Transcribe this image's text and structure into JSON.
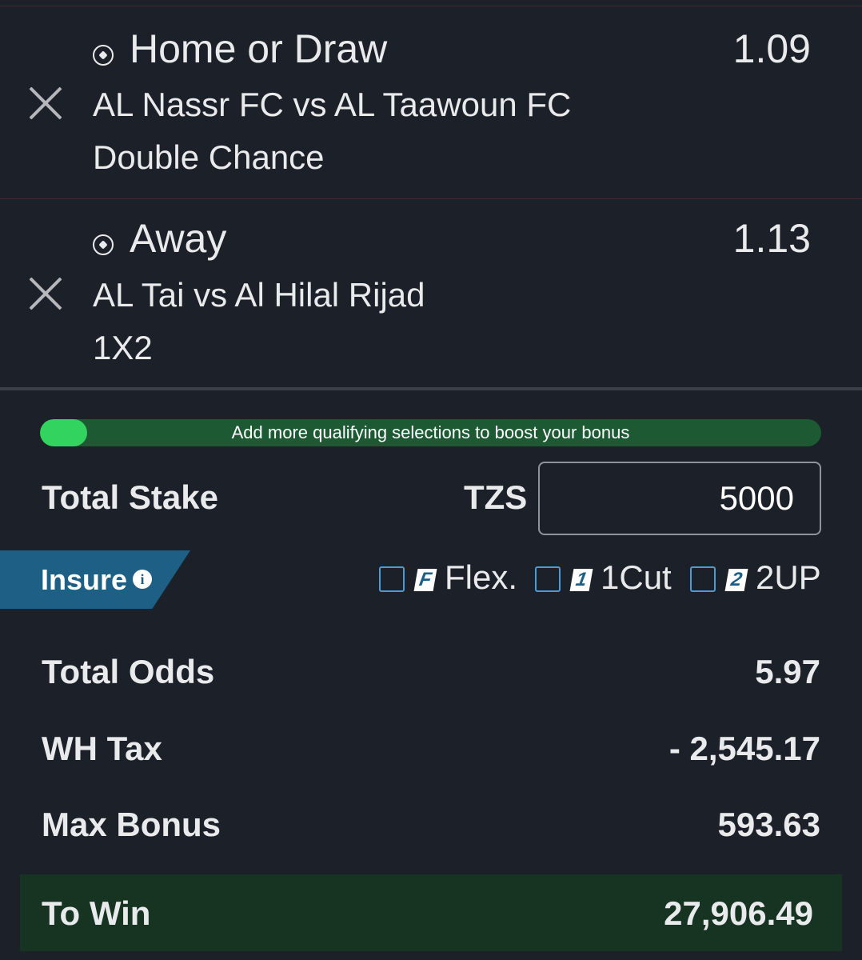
{
  "selections": [
    {
      "pick": "Home or Draw",
      "odds": "1.09",
      "match": "AL Nassr FC vs AL Taawoun FC",
      "market": "Double Chance",
      "icon": "soccer-ball-icon"
    },
    {
      "pick": "Away",
      "odds": "1.13",
      "match": "AL Tai vs Al Hilal Rijad",
      "market": "1X2",
      "icon": "soccer-ball-icon"
    }
  ],
  "bonus": {
    "message": "Add more qualifying selections to boost your bonus",
    "progress": 0.06,
    "fill_color": "#32d45f",
    "track_color": "#1d5a33"
  },
  "stake": {
    "label": "Total Stake",
    "currency": "TZS",
    "value": "5000"
  },
  "insure": {
    "label": "Insure",
    "info_icon": "i",
    "options": [
      {
        "badge": "F",
        "label": "Flex."
      },
      {
        "badge": "1",
        "label": "1Cut"
      },
      {
        "badge": "2",
        "label": "2UP"
      }
    ]
  },
  "summary": {
    "total_odds_label": "Total Odds",
    "total_odds": "5.97",
    "wh_tax_label": "WH Tax",
    "wh_tax": "- 2,545.17",
    "max_bonus_label": "Max Bonus",
    "max_bonus": "593.63"
  },
  "to_win": {
    "label": "To Win",
    "value": "27,906.49"
  }
}
